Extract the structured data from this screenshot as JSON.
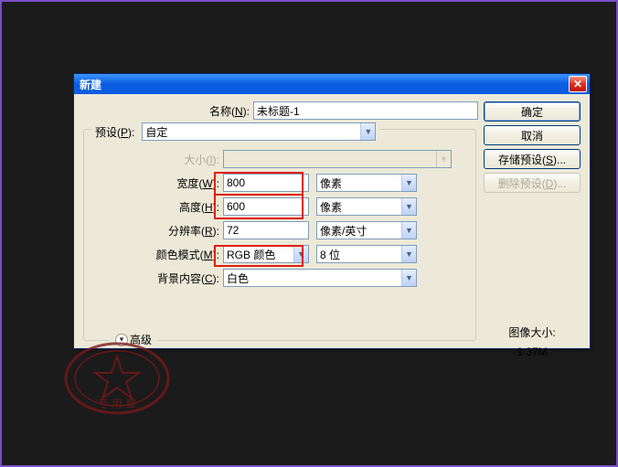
{
  "dialog": {
    "title": "新建",
    "name_label": "名称(N):",
    "name_value": "未标题-1",
    "preset_label": "预设(P):",
    "preset_value": "自定",
    "size_label": "大小(I):",
    "width_label": "宽度(W):",
    "width_value": "800",
    "width_unit": "像素",
    "height_label": "高度(H):",
    "height_value": "600",
    "height_unit": "像素",
    "resolution_label": "分辨率(R):",
    "resolution_value": "72",
    "resolution_unit": "像素/英寸",
    "color_mode_label": "颜色模式(M):",
    "color_mode_value": "RGB 颜色",
    "color_depth_value": "8 位",
    "bg_label": "背景内容(C):",
    "bg_value": "白色",
    "advanced_label": "高级",
    "image_size_label": "图像大小:",
    "image_size_value": "1.37M"
  },
  "buttons": {
    "ok": "确定",
    "cancel": "取消",
    "save_preset": "存储预设(S)...",
    "delete_preset": "删除预设(D)..."
  }
}
